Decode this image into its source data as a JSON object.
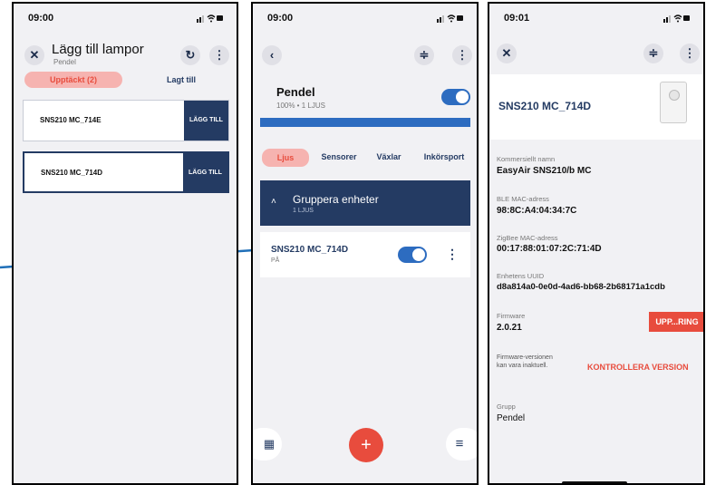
{
  "screen1": {
    "time": "09:00",
    "title": "Lägg till lampor",
    "subtitle": "Pendel",
    "tab_discovered": "Upptäckt (2)",
    "tab_added": "Lagt till",
    "devices": [
      {
        "name": "SNS210 MC_714E",
        "action": "LÄGG TILL"
      },
      {
        "name": "SNS210 MC_714D",
        "action": "LÄGG TILL"
      }
    ]
  },
  "screen2": {
    "time": "09:00",
    "group_name": "Pendel",
    "group_sub": "100% • 1 LJUS",
    "tabs": [
      "Ljus",
      "Sensorer",
      "Växlar",
      "Inkörsport"
    ],
    "section_title": "Gruppera enheter",
    "section_sub": "1 LJUS",
    "device_name": "SNS210 MC_714D",
    "device_state": "PÅ",
    "fab": "+"
  },
  "screen3": {
    "time": "09:01",
    "device_title": "SNS210 MC_714D",
    "fields": [
      {
        "label": "Kommersiellt namn",
        "value": "EasyAir SNS210/b MC"
      },
      {
        "label": "BLE MAC-adress",
        "value": "98:8C:A4:04:34:7C"
      },
      {
        "label": "ZigBee MAC-adress",
        "value": "00:17:88:01:07:2C:71:4D"
      },
      {
        "label": "Enhetens UUID",
        "value": "d8a814a0-0e0d-4ad6-bb68-2b68171a1cdb"
      },
      {
        "label": "Firmware",
        "value": "2.0.21"
      }
    ],
    "upgrade_label": "UPP...RING",
    "fw_warning": "Firmware-versionen kan vara inaktuell.",
    "check_version": "KONTROLLERA VERSION",
    "group_label": "Grupp",
    "group_value": "Pendel"
  },
  "colors": {
    "accent": "#2d6cc0",
    "navy": "#243b63",
    "red": "#e84c3d",
    "pink": "#f6b3b0"
  }
}
